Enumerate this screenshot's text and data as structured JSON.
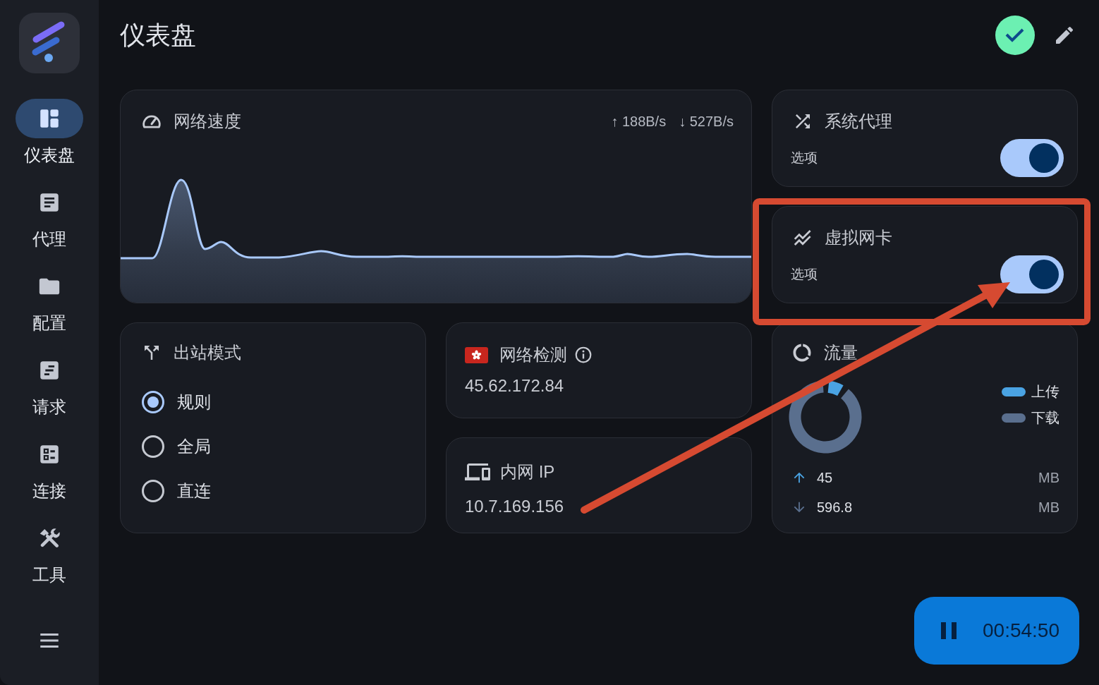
{
  "sidebar": {
    "items": [
      {
        "label": "仪表盘",
        "selected": true
      },
      {
        "label": "代理",
        "selected": false
      },
      {
        "label": "配置",
        "selected": false
      },
      {
        "label": "请求",
        "selected": false
      },
      {
        "label": "连接",
        "selected": false
      },
      {
        "label": "工具",
        "selected": false
      }
    ]
  },
  "header": {
    "title": "仪表盘"
  },
  "network_speed": {
    "title": "网络速度",
    "upload": "↑ 188B/s",
    "download": "↓ 527B/s"
  },
  "system_proxy": {
    "title": "系统代理",
    "label": "选项",
    "on": true
  },
  "virtual_nic": {
    "title": "虚拟网卡",
    "label": "选项",
    "on": true
  },
  "outbound_mode": {
    "title": "出站模式",
    "options": [
      {
        "label": "规则",
        "selected": true
      },
      {
        "label": "全局",
        "selected": false
      },
      {
        "label": "直连",
        "selected": false
      }
    ]
  },
  "network_check": {
    "title": "网络检测",
    "ip": "45.62.172.84"
  },
  "lan_ip": {
    "title": "内网 IP",
    "ip": "10.7.169.156"
  },
  "traffic": {
    "title": "流量",
    "chart_data": {
      "type": "donut",
      "categories": [
        "上传",
        "下载"
      ],
      "series": [
        {
          "values": [
            7.01,
            92.99
          ]
        }
      ]
    },
    "legend": [
      {
        "color": "#4aa3e3"
      },
      {
        "color": "#5a6f8e"
      }
    ],
    "rows": [
      {
        "value": "45",
        "unit": "MB"
      },
      {
        "value": "596.8",
        "unit": "MB"
      }
    ]
  },
  "timer": {
    "time": "00:54:50"
  }
}
